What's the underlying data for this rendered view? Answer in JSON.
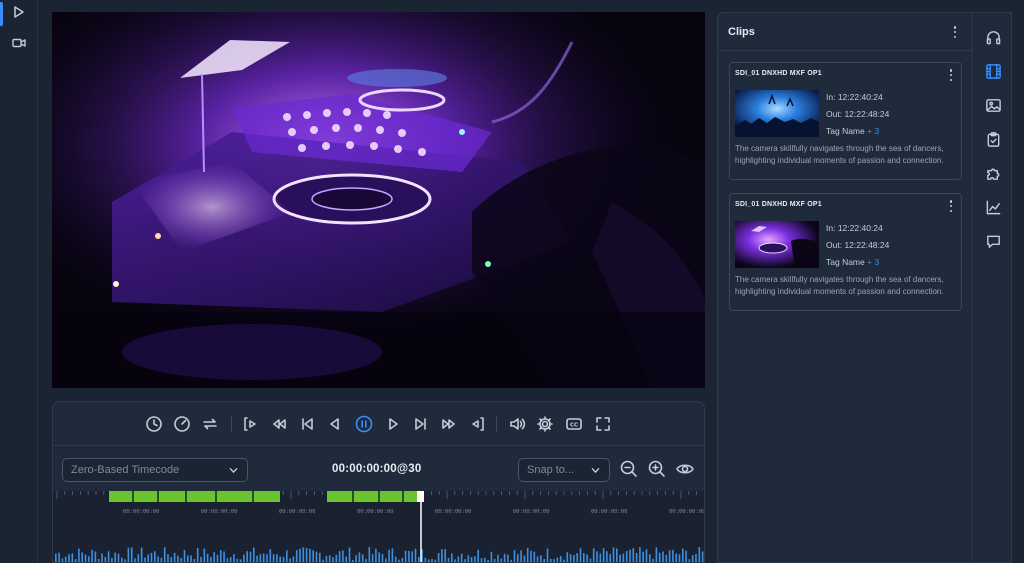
{
  "left_rail": {
    "items": [
      {
        "icon": "play-icon",
        "active": true
      },
      {
        "icon": "camera-icon",
        "active": false
      }
    ]
  },
  "player": {
    "transport_icons": [
      "clock-icon",
      "speedometer-icon",
      "loop-icon",
      "mark-in-icon",
      "rewind-icon",
      "skip-start-icon",
      "step-back-icon",
      "pause-icon",
      "step-forward-icon",
      "skip-end-icon",
      "fast-forward-icon",
      "mark-out-icon",
      "volume-icon",
      "settings-icon",
      "closed-captions-icon",
      "fullscreen-icon"
    ],
    "cc_label": "CC",
    "timecode_mode": "Zero-Based Timecode",
    "current_timecode": "00:00:00:00@30",
    "snap_placeholder": "Snap to...",
    "tool_icons": [
      "zoom-out-icon",
      "zoom-in-icon",
      "eye-icon"
    ]
  },
  "timeline": {
    "tick_labels": [
      "00:00:00:00",
      "00:00:00:00",
      "00:00:00:00",
      "00:00:00:00",
      "00:00:00:00",
      "00:00:00:00",
      "00:00:00:00",
      "00:00:00:00"
    ],
    "colors": {
      "segment": "#69c430",
      "waveform": "#3e8fe0",
      "playhead": "#ffffff"
    }
  },
  "clips_panel": {
    "title": "Clips",
    "clips": [
      {
        "name": "SDI_01 DNXHD MXF OP1",
        "in_label": "In:",
        "in_value": "12:22:40:24",
        "out_label": "Out:",
        "out_value": "12:22:48:24",
        "tag": "Tag Name",
        "tag_more": "+ 3",
        "description": "The camera skillfully navigates through the sea of dancers, highlighting individual moments of passion and connection."
      },
      {
        "name": "SDI_01 DNXHD MXF OP1",
        "in_label": "In:",
        "in_value": "12:22:40:24",
        "out_label": "Out:",
        "out_value": "12:22:48:24",
        "tag": "Tag Name",
        "tag_more": "+ 3",
        "description": "The camera skillfully navigates through the sea of dancers, highlighting individual moments of passion and connection."
      }
    ]
  },
  "right_rail": {
    "items": [
      "headphones-icon",
      "film-icon",
      "image-icon",
      "clipboard-check-icon",
      "puzzle-icon",
      "chart-line-icon",
      "comment-icon"
    ],
    "active": "film-icon"
  },
  "colors": {
    "accent": "#3b8cff",
    "background": "#1b2433",
    "panel": "#1f2a3b"
  }
}
